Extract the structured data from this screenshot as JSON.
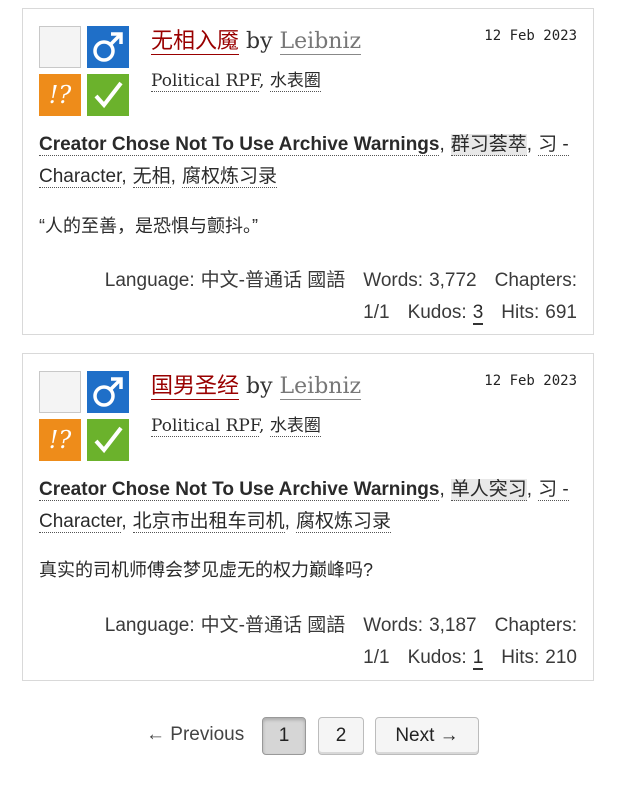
{
  "works": [
    {
      "title": "无相入魇",
      "by": "by",
      "author": "Leibniz",
      "fandoms": [
        "Political RPF",
        "水表圈"
      ],
      "date": "12 Feb 2023",
      "warning_tag": "Creator Chose Not To Use Archive Warnings",
      "tags": [
        "群习荟萃",
        "习 - Character",
        "无相",
        "腐权炼习录"
      ],
      "summary": "“人的至善，是恐惧与颤抖。”",
      "stats": {
        "language_label": "Language:",
        "language": "中文-普通话 國語",
        "words_label": "Words:",
        "words": "3,772",
        "chapters_label": "Chapters:",
        "chapters": "1/1",
        "kudos_label": "Kudos:",
        "kudos": "3",
        "hits_label": "Hits:",
        "hits": "691"
      }
    },
    {
      "title": "国男圣经",
      "by": "by",
      "author": "Leibniz",
      "fandoms": [
        "Political RPF",
        "水表圈"
      ],
      "date": "12 Feb 2023",
      "warning_tag": "Creator Chose Not To Use Archive Warnings",
      "tags": [
        "单人突习",
        "习 - Character",
        "北京市出租车司机",
        "腐权炼习录"
      ],
      "summary": "真实的司机师傅会梦见虚无的权力巅峰吗?",
      "stats": {
        "language_label": "Language:",
        "language": "中文-普通话 國語",
        "words_label": "Words:",
        "words": "3,187",
        "chapters_label": "Chapters:",
        "chapters": "1/1",
        "kudos_label": "Kudos:",
        "kudos": "1",
        "hits_label": "Hits:",
        "hits": "210"
      }
    }
  ],
  "icons": {
    "rating": "rating-not-rated-icon",
    "category": "male-symbol-icon",
    "category_glyph": "♂",
    "warning": "warning-choose-not-icon",
    "warning_glyph": "!?",
    "complete": "checkmark-complete-icon",
    "colors": {
      "category": "#1f6fc8",
      "warning": "#ee8c1a",
      "complete": "#6bb22c",
      "title": "#990000"
    }
  },
  "pagination": {
    "previous": "← Previous",
    "pages": [
      "1",
      "2"
    ],
    "current": "1",
    "next": "Next →"
  }
}
